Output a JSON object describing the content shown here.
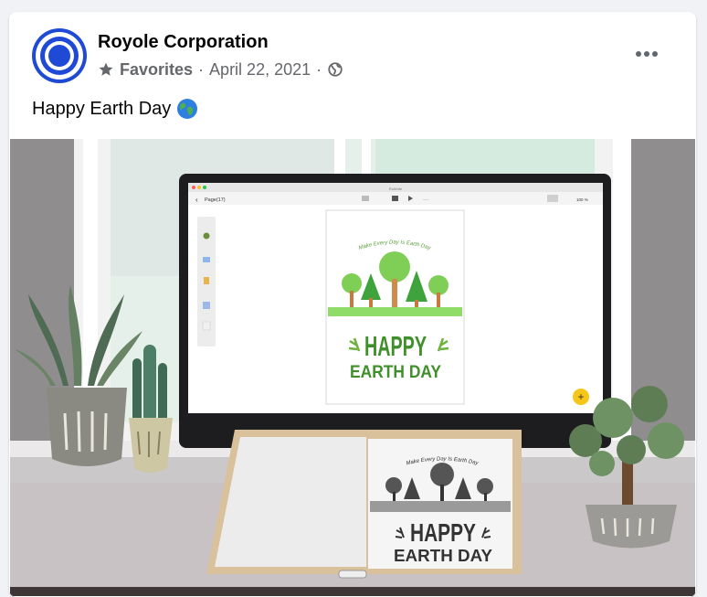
{
  "post": {
    "author": "Royole Corporation",
    "audience_label": "Favorites",
    "separator": "·",
    "date": "April 22, 2021",
    "text": "Happy Earth Day",
    "emoji_icon": "earth-globe-emoji"
  },
  "image": {
    "app_page_label": "Page(17)",
    "window_title": "RoWrite",
    "zoom": "100 %",
    "arc_text": "Make Every Day Is Earth Day",
    "headline_1": "HAPPY",
    "headline_2": "EARTH DAY",
    "add_button_label": "+"
  },
  "colors": {
    "brand_blue": "#1f4ad6",
    "earth_green": "#3f8f2a"
  }
}
